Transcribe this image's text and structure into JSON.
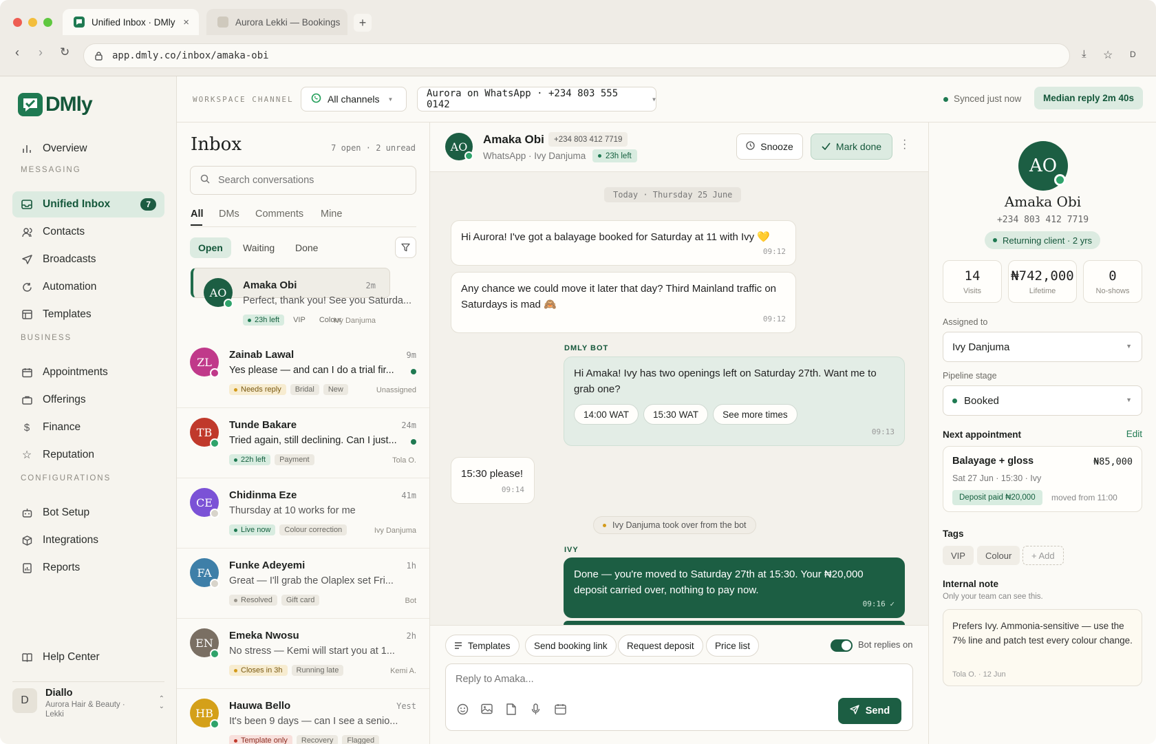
{
  "browser": {
    "tabs": [
      {
        "label": "Unified Inbox · DMly",
        "active": true
      },
      {
        "label": "Aurora Lekki — Bookings",
        "active": false
      }
    ],
    "url": "app.dmly.co/inbox/amaka-obi",
    "profile_initial": "D"
  },
  "brand": {
    "name": "DMly",
    "color": "#14573a",
    "accent": "#1f7a52"
  },
  "sidebar": {
    "overview": "Overview",
    "messaging_heading": "MESSAGING",
    "messaging": [
      {
        "label": "Unified Inbox",
        "icon": "inbox-icon",
        "badge": "7",
        "active": true
      },
      {
        "label": "Contacts",
        "icon": "contacts-icon"
      },
      {
        "label": "Broadcasts",
        "icon": "send-icon"
      },
      {
        "label": "Automation",
        "icon": "refresh-icon"
      },
      {
        "label": "Templates",
        "icon": "template-icon"
      }
    ],
    "business_heading": "BUSINESS",
    "business": [
      {
        "label": "Appointments",
        "icon": "calendar-icon"
      },
      {
        "label": "Offerings",
        "icon": "bag-icon"
      },
      {
        "label": "Finance",
        "icon": "dollar-icon"
      },
      {
        "label": "Reputation",
        "icon": "star-icon"
      }
    ],
    "config_heading": "CONFIGURATIONS",
    "config": [
      {
        "label": "Bot Setup",
        "icon": "bot-icon"
      },
      {
        "label": "Integrations",
        "icon": "cube-icon"
      },
      {
        "label": "Reports",
        "icon": "report-icon"
      }
    ],
    "help": "Help Center",
    "account": {
      "initial": "D",
      "name": "Diallo",
      "org_line1": "Aurora Hair & Beauty ·",
      "org_line2": "Lekki"
    }
  },
  "topbar": {
    "label": "WORKSPACE CHANNEL",
    "channel_filter": "All channels",
    "number": "Aurora on WhatsApp · +234 803 555 0142",
    "sync_status": "Synced just now",
    "median_reply": "Median reply 2m 40s"
  },
  "inbox": {
    "title": "Inbox",
    "counts": "7 open · 2 unread",
    "search_placeholder": "Search conversations",
    "filter_tabs": [
      "All",
      "DMs",
      "Comments",
      "Mine"
    ],
    "status_tabs": [
      "Open",
      "Waiting",
      "Done"
    ],
    "conversations": [
      {
        "initials": "AO",
        "color": "#1c5e43",
        "name": "Amaka Obi",
        "time": "2m",
        "preview": "Perfect, thank you! See you Saturda...",
        "unread": false,
        "selected": true,
        "tags": [
          {
            "text": "23h left",
            "style": "g",
            "dot": true
          },
          {
            "text": "VIP",
            "style": "gr"
          },
          {
            "text": "Colour",
            "style": "gr"
          }
        ],
        "assignee": "Ivy Danjuma"
      },
      {
        "initials": "ZL",
        "color": "#c0398a",
        "name": "Zainab Lawal",
        "time": "9m",
        "preview": "Yes please — and can I do a trial fir...",
        "unread": true,
        "tags": [
          {
            "text": "Needs reply",
            "style": "y",
            "dot": true
          },
          {
            "text": "Bridal",
            "style": "gr"
          },
          {
            "text": "New",
            "style": "gr"
          }
        ],
        "assignee": "Unassigned"
      },
      {
        "initials": "TB",
        "color": "#c0392b",
        "name": "Tunde Bakare",
        "time": "24m",
        "preview": "Tried again, still declining. Can I just...",
        "unread": true,
        "tags": [
          {
            "text": "22h left",
            "style": "g",
            "dot": true
          },
          {
            "text": "Payment",
            "style": "gr"
          }
        ],
        "assignee": "Tola O."
      },
      {
        "initials": "CE",
        "color": "#7b52d6",
        "name": "Chidinma Eze",
        "time": "41m",
        "preview": "Thursday at 10 works for me",
        "unread": false,
        "tags": [
          {
            "text": "Live now",
            "style": "g",
            "dot": true
          },
          {
            "text": "Colour correction",
            "style": "gr"
          }
        ],
        "assignee": "Ivy Danjuma"
      },
      {
        "initials": "FA",
        "color": "#3e7fa8",
        "name": "Funke Adeyemi",
        "time": "1h",
        "preview": "Great — I'll grab the Olaplex set Fri...",
        "unread": false,
        "tags": [
          {
            "text": "Resolved",
            "style": "gr",
            "dot": true
          },
          {
            "text": "Gift card",
            "style": "gr"
          }
        ],
        "assignee": "Bot"
      },
      {
        "initials": "EN",
        "color": "#7a6f63",
        "name": "Emeka Nwosu",
        "time": "2h",
        "preview": "No stress — Kemi will start you at 1...",
        "unread": false,
        "tags": [
          {
            "text": "Closes in 3h",
            "style": "y",
            "dot": true
          },
          {
            "text": "Running late",
            "style": "gr"
          }
        ],
        "assignee": "Kemi A."
      },
      {
        "initials": "HB",
        "color": "#d4a019",
        "name": "Hauwa Bello",
        "time": "Yest",
        "preview": "It's been 9 days — can I see a senio...",
        "unread": false,
        "tags": [
          {
            "text": "Template only",
            "style": "r",
            "dot": true
          },
          {
            "text": "Recovery",
            "style": "gr"
          },
          {
            "text": "Flagged",
            "style": "gr"
          }
        ],
        "assignee": ""
      }
    ]
  },
  "chat": {
    "contact": {
      "initials": "AO",
      "name": "Amaka Obi",
      "phone": "+234 803 412 7719",
      "channel": "WhatsApp · Ivy Danjuma",
      "window": "23h left"
    },
    "snooze": "Snooze",
    "mark_done": "Mark done",
    "date_divider": "Today · Thursday 25 June",
    "messages": {
      "m1": {
        "text": "Hi Aurora! I've got a balayage booked for Saturday at 11 with Ivy 💛",
        "time": "09:12"
      },
      "m2": {
        "text": "Any chance we could move it later that day? Third Mainland traffic on Saturdays is mad 🙈",
        "time": "09:12"
      },
      "bot_label": "DMLY BOT",
      "m3": {
        "text": "Hi Amaka! Ivy has two openings left on Saturday 27th. Want me to grab one?",
        "time": "09:13",
        "options": [
          "14:00 WAT",
          "15:30 WAT",
          "See more times"
        ]
      },
      "m4": {
        "text": "15:30 please!",
        "time": "09:14"
      },
      "event": "Ivy Danjuma took over from the bot",
      "agent_label": "IVY",
      "m5": {
        "text": "Done — you're moved to Saturday 27th at 15:30. Your ₦20,000 deposit carried over, nothing to pay now.",
        "time": "09:16"
      }
    },
    "quick_actions": [
      "Templates",
      "Send booking link",
      "Request deposit",
      "Price list"
    ],
    "bot_toggle": "Bot replies on",
    "reply_placeholder": "Reply to Amaka...",
    "send": "Send"
  },
  "profile": {
    "initials": "AO",
    "name": "Amaka Obi",
    "phone": "+234 803 412 7719",
    "status": "Returning client · 2 yrs",
    "stats": [
      {
        "value": "14",
        "label": "Visits"
      },
      {
        "value": "₦742,000",
        "label": "Lifetime"
      },
      {
        "value": "0",
        "label": "No-shows"
      }
    ],
    "assigned_label": "Assigned to",
    "assigned": "Ivy Danjuma",
    "pipeline_label": "Pipeline stage",
    "pipeline": "Booked",
    "next_label": "Next appointment",
    "edit": "Edit",
    "appointment": {
      "service": "Balayage + gloss",
      "price": "₦85,000",
      "when": "Sat 27 Jun · 15:30 · Ivy",
      "deposit": "Deposit paid ₦20,000",
      "note": "moved from 11:00"
    },
    "tags_label": "Tags",
    "tags": [
      "VIP",
      "Colour"
    ],
    "add_tag": "+ Add",
    "note_label": "Internal note",
    "note_sub": "Only your team can see this.",
    "note_text": "Prefers Ivy. Ammonia-sensitive — use the 7% line and patch test every colour change.",
    "note_meta": "Tola O. · 12 Jun"
  }
}
